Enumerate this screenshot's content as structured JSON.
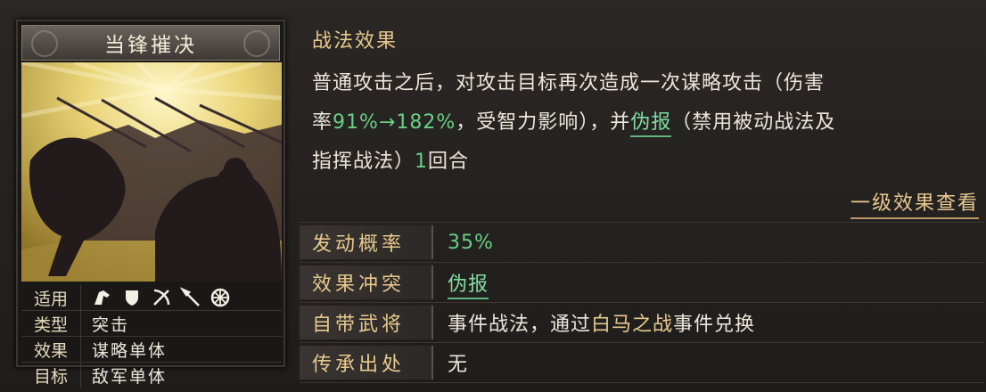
{
  "card": {
    "name": "当锋摧决",
    "props": [
      {
        "key": "适用",
        "value": "",
        "icons": [
          "cavalry-icon",
          "shield-icon",
          "bow-icon",
          "spear-icon",
          "chariot-icon"
        ]
      },
      {
        "key": "类型",
        "value": "突击"
      },
      {
        "key": "效果",
        "value": "谋略单体"
      },
      {
        "key": "目标",
        "value": "敌军单体"
      }
    ]
  },
  "effect": {
    "title": "战法效果",
    "line1": "普通攻击之后，对攻击目标再次造成一次谋略攻击（伤害",
    "line2_pre": "率",
    "line2_rate": "91%→182%",
    "line2_mid": "，受智力影响），并",
    "line2_link": "伪报",
    "line2_post": "（禁用被动战法及",
    "line3_pre": "指挥战法）",
    "line3_num": "1",
    "line3_post": "回合",
    "view_link": "一级效果查看"
  },
  "attributes": {
    "rate_label": "发动概率",
    "rate_value": "35%",
    "conflict_label": "效果冲突",
    "conflict_value": "伪报",
    "general_label": "自带武将",
    "general_pre": "事件战法，通过",
    "general_event": "白马之战",
    "general_post": "事件兑换",
    "inherit_label": "传承出处",
    "inherit_value": "无"
  }
}
